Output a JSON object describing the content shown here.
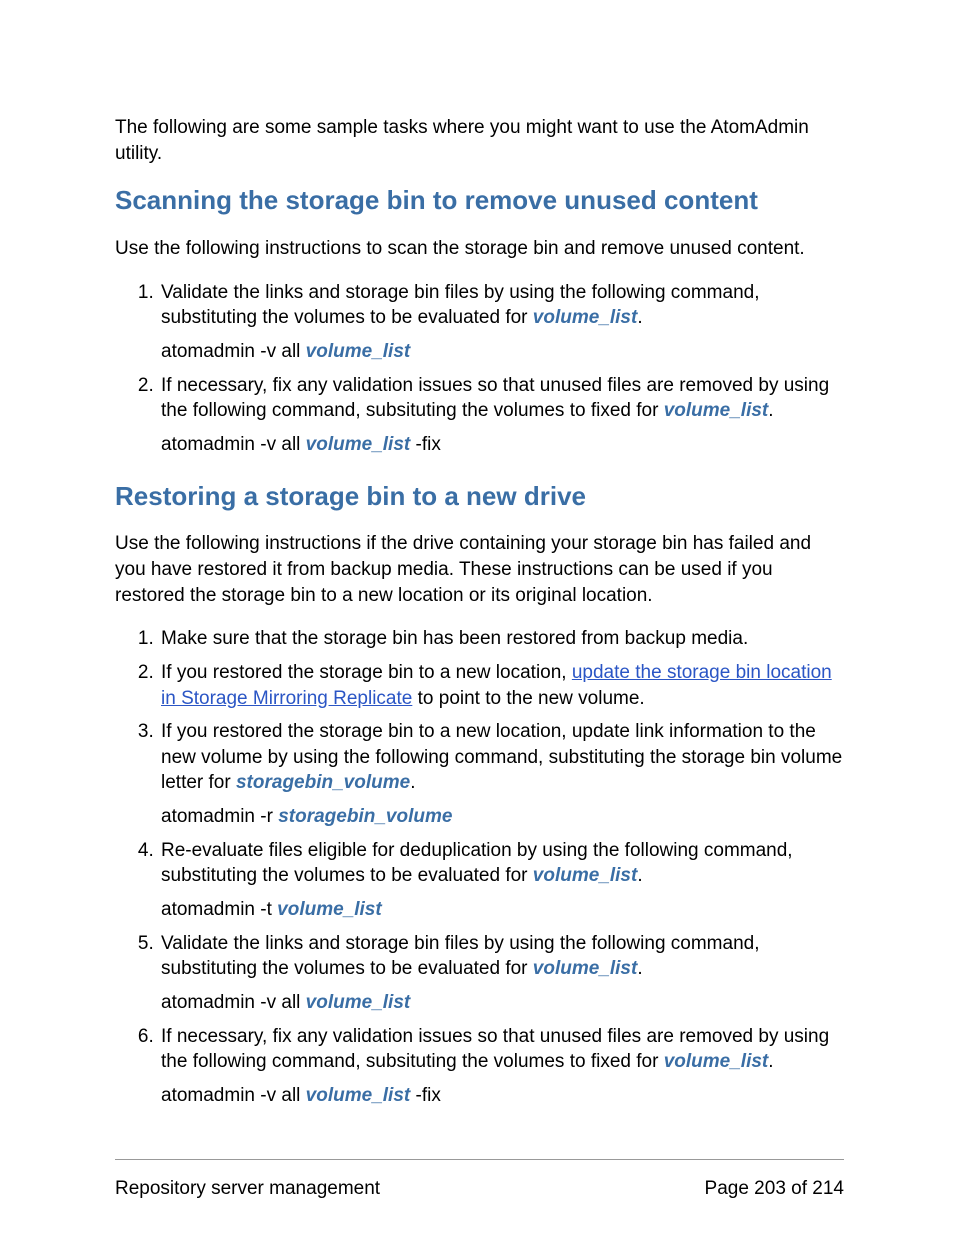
{
  "intro": "The following are some sample tasks where you might want to use the AtomAdmin utility.",
  "section1": {
    "heading": "Scanning the storage bin to remove unused content",
    "intro": "Use the following instructions to scan the storage bin and remove unused content.",
    "step1_a": "Validate the links and storage bin files by using the following command, substituting the volumes to be evaluated for ",
    "step1_var": "volume_list",
    "step1_b": ".",
    "step1_cmd_a": "atomadmin -v all ",
    "step1_cmd_var": "volume_list",
    "step2_a": "If necessary, fix any validation issues so that unused files are removed by using the following command, subsituting the volumes to fixed for ",
    "step2_var": "volume_list",
    "step2_b": ".",
    "step2_cmd_a": "atomadmin -v all ",
    "step2_cmd_var": "volume_list",
    "step2_cmd_b": " -fix"
  },
  "section2": {
    "heading": "Restoring a storage bin to a new drive",
    "intro": "Use the following instructions if the drive containing your storage bin has failed and you have restored it from backup media. These instructions can be used if you restored the storage bin to a new location or its original location.",
    "step1": "Make sure that the storage bin has been restored from backup media.",
    "step2_a": "If you restored the storage bin to a new location, ",
    "step2_link": "update the storage bin location in Storage Mirroring Replicate",
    "step2_b": " to point to the new volume.",
    "step3_a": "If you restored the storage bin to a new location, update link information to the new volume by using the following command, substituting the storage bin volume letter for ",
    "step3_var": "storagebin_volume",
    "step3_b": ".",
    "step3_cmd_a": "atomadmin -r ",
    "step3_cmd_var": "storagebin_volume",
    "step4_a": "Re-evaluate files eligible for deduplication by using the following command, substituting the volumes to be evaluated for ",
    "step4_var": "volume_list",
    "step4_b": ".",
    "step4_cmd_a": "atomadmin -t ",
    "step4_cmd_var": "volume_list",
    "step5_a": "Validate the links and storage bin files by using the following command, substituting the volumes to be evaluated for ",
    "step5_var": "volume_list",
    "step5_b": ".",
    "step5_cmd_a": "atomadmin -v all ",
    "step5_cmd_var": "volume_list",
    "step6_a": "If necessary, fix any validation issues so that unused files are removed by using the following command, subsituting the volumes to fixed for ",
    "step6_var": "volume_list",
    "step6_b": ".",
    "step6_cmd_a": "atomadmin -v all ",
    "step6_cmd_var": "volume_list",
    "step6_cmd_b": " -fix"
  },
  "footer": {
    "left": "Repository server management",
    "right": "Page 203 of 214"
  }
}
